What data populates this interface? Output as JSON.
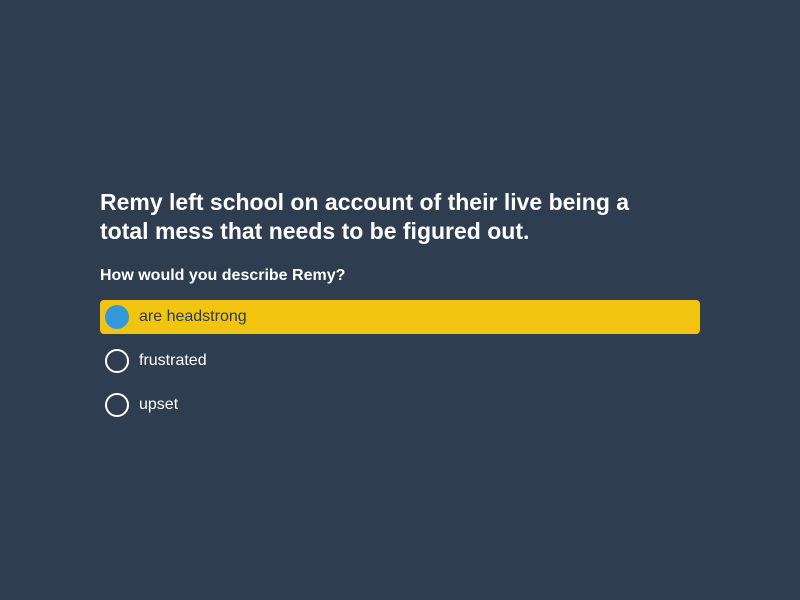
{
  "question": {
    "text": "Remy left school on account of their live being a total mess that needs to be figured out.",
    "prompt": "How would you describe Remy?"
  },
  "options": [
    {
      "label": "are headstrong",
      "selected": true
    },
    {
      "label": "frustrated",
      "selected": false
    },
    {
      "label": "upset",
      "selected": false
    }
  ],
  "colors": {
    "background": "#2e3e50",
    "selected_background": "#f1c40f",
    "selected_radio": "#3498db",
    "text": "#ffffff"
  }
}
